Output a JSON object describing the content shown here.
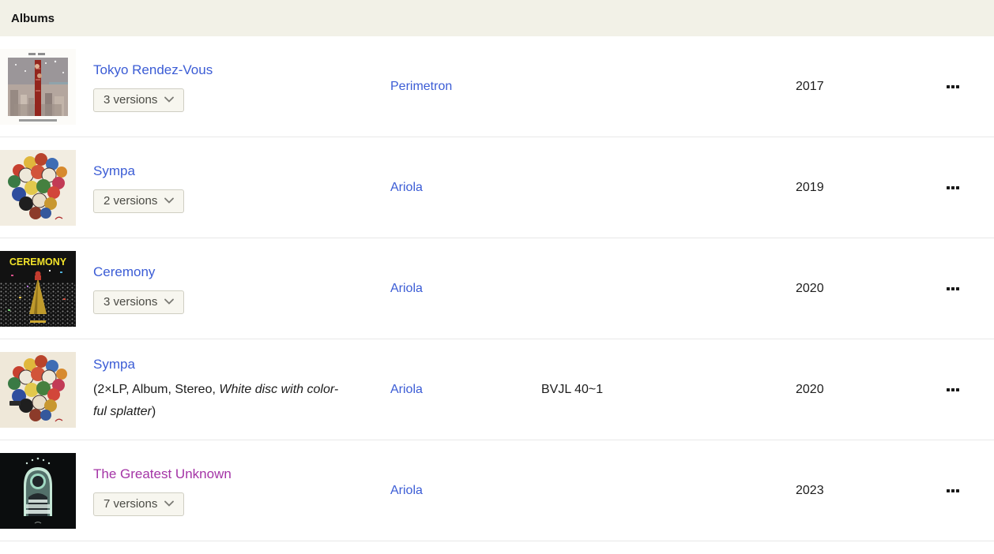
{
  "page": {
    "header": "Albums"
  },
  "colors": {
    "link": "#3b5cd5",
    "visited_link": "#a434a6",
    "header_bg": "#f2f1e7"
  },
  "albums": [
    {
      "title": "Tokyo Rendez-Vous",
      "versions": "3 versions",
      "label": "Perimetron",
      "catno": "",
      "year": "2017",
      "art": "tokyo-rendez-vous-cover"
    },
    {
      "title": "Sympa",
      "versions": "2 versions",
      "label": "Ariola",
      "catno": "",
      "year": "2019",
      "art": "sympa-cover"
    },
    {
      "title": "Ceremony",
      "versions": "3 versions",
      "label": "Ariola",
      "catno": "",
      "year": "2020",
      "art": "ceremony-cover",
      "art_text": "CEREMONY"
    },
    {
      "title": "Sympa",
      "format_pre": "(2×LP, Album, Stereo, ",
      "format_italic_1": "White disc with color-",
      "format_italic_2": "ful splatter",
      "format_post": ")",
      "label": "Ariola",
      "catno": "BVJL 40~1",
      "year": "2020",
      "art": "sympa-cover"
    },
    {
      "title": "The Greatest Unknown",
      "visited": true,
      "versions": "7 versions",
      "label": "Ariola",
      "catno": "",
      "year": "2023",
      "art": "the-greatest-unknown-cover"
    }
  ]
}
